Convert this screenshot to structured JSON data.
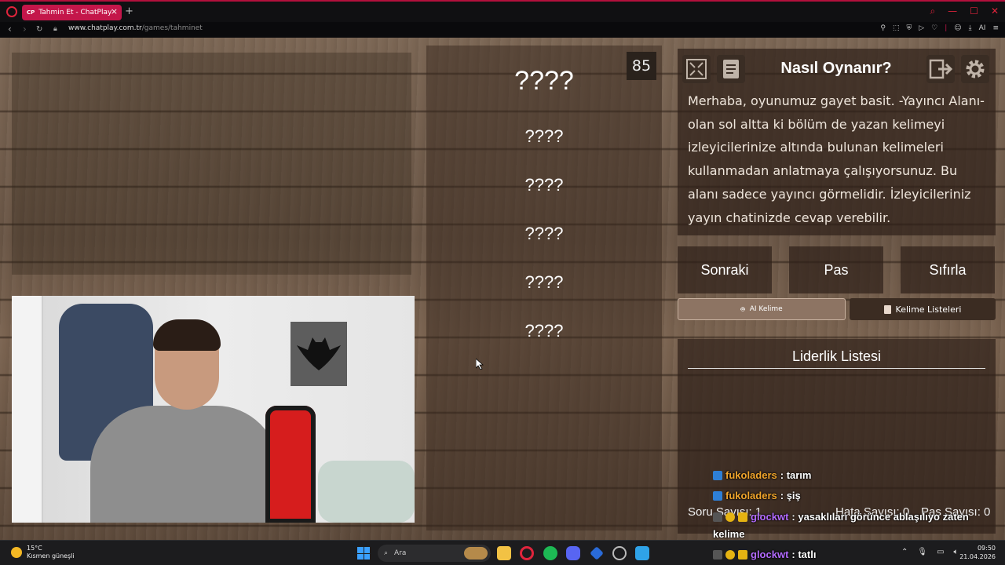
{
  "browser": {
    "tab_title": "Tahmin Et - ChatPlay",
    "tab_favicon": "CP",
    "url_host": "www.chatplay.com.tr",
    "url_path": "/games/tahminet",
    "addr_ai_label": "AI"
  },
  "game": {
    "counter": "85",
    "main_word": "????",
    "forbidden_words": [
      "????",
      "????",
      "????",
      "????",
      "????"
    ],
    "how_to_title": "Nasıl Oynanır?",
    "how_to_text": "Merhaba, oyunumuz gayet basit. -Yayıncı Alanı- olan sol altta ki bölüm de yazan kelimeyi izleyicilerinize altında bulunan kelimeleri kullanmadan anlatmaya çalışıyorsunuz. Bu alanı sadece yayıncı görmelidir. İzleyicileriniz yayın chatinizde cevap verebilir.",
    "buttons": {
      "next": "Sonraki",
      "pass": "Pas",
      "reset": "Sıfırla",
      "ai_word": "AI Kelime",
      "word_lists": "Kelime Listeleri"
    },
    "leaderboard_title": "Liderlik Listesi",
    "stats": {
      "question_count": "Soru Sayısı: 1",
      "error_count": "Hata Sayısı: 0",
      "pass_count": "Pas Sayısı: 0"
    }
  },
  "chat": [
    {
      "user": "fukoladers",
      "message": ": tarım"
    },
    {
      "user": "fukoladers",
      "message": ": şiş"
    },
    {
      "user": "glockwt",
      "message": ": yasaklıları görünce ablaşılıyo zaten"
    },
    {
      "user": "",
      "message": "kelime"
    },
    {
      "user": "glockwt",
      "message": ": tatlı"
    }
  ],
  "taskbar": {
    "weather_temp": "15°C",
    "weather_desc": "Kısmen güneşli",
    "search_placeholder": "Ara",
    "time": "09:50",
    "date": "21.04.2026"
  }
}
